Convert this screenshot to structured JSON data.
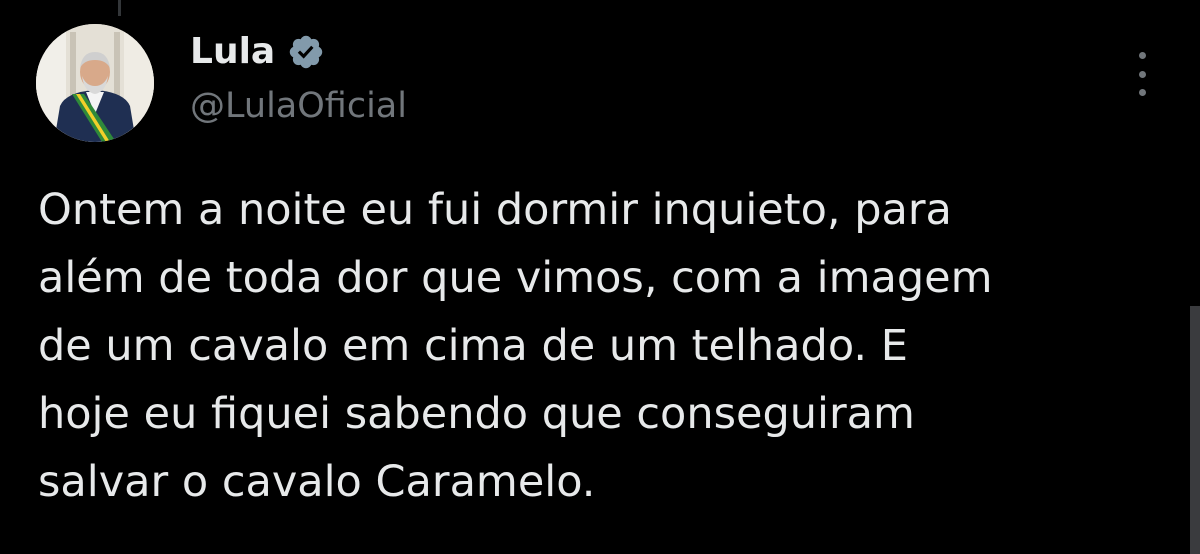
{
  "author": {
    "display_name": "Lula",
    "handle": "@LulaOficial",
    "verified": true,
    "verified_color": "#829aab"
  },
  "tweet": {
    "lines": [
      "Ontem a noite eu fui dormir inquieto, para",
      "além de toda dor que vimos, com a imagem",
      "de um cavalo em cima de um telhado. E",
      "hoje eu fiquei sabendo que conseguiram",
      "salvar o cavalo Caramelo."
    ]
  },
  "icons": {
    "verified": "verified-badge-icon",
    "more": "more-options-icon"
  },
  "colors": {
    "background": "#000000",
    "text_primary": "#e7e9ea",
    "text_secondary": "#71767b"
  }
}
